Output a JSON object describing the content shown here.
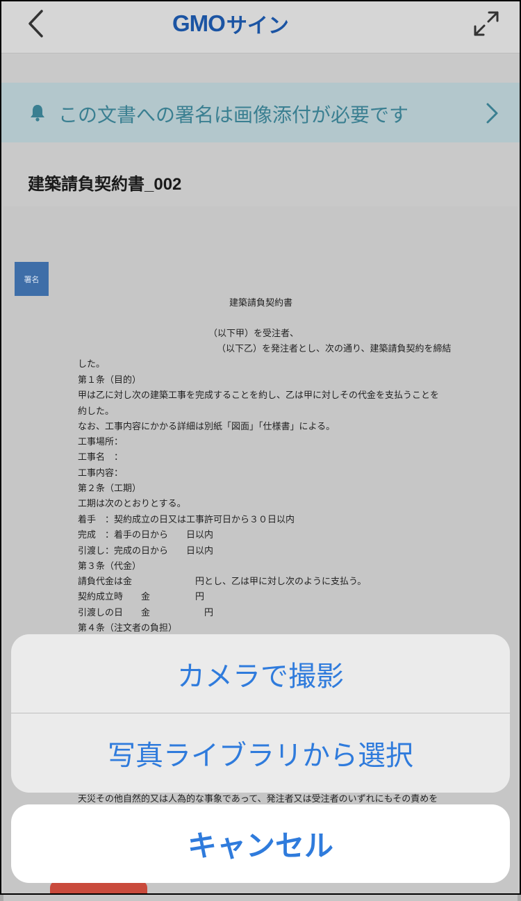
{
  "header": {
    "logo_gmo": "GMO",
    "logo_sign": "サイン"
  },
  "notice": {
    "text": "この文書への署名は画像添付が必要です"
  },
  "document": {
    "title": "建築請負契約書_002",
    "signature_label": "署名",
    "lines": [
      "建築請負契約書",
      "（以下甲）を受注者、",
      "（以下乙）を発注者とし、次の通り、建築請負契約を締結",
      "した。",
      "第１条（目的）",
      "甲は乙に対し次の建築工事を完成することを約し、乙は甲に対しその代金を支払うことを",
      "約した。",
      "なお、工事内容にかかる詳細は別紙「図面」「仕様書」による。",
      "工事場所：",
      "工事名　：",
      "工事内容：",
      "第２条（工期）",
      "工期は次のとおりとする。",
      "着手　：契約成立の日又は工事許可日から３０日以内",
      "完成　：着手の日から　　日以内",
      "引渡し：完成の日から　　日以内",
      "第３条（代金）",
      "請負代金は金　　　　　　　円とし、乙は甲に対し次のように支払う。",
      "契約成立時　　金　　　　　円",
      "引渡しの日　　金　　　　　　円",
      "第４条（注文者の負担）",
      "天災その他自然的又は人為的な事象であって、発注者又は受注者のいずれにもその責めを"
    ]
  },
  "action_sheet": {
    "camera_label": "カメラで撮影",
    "library_label": "写真ライブラリから選択",
    "cancel_label": "キャンセル"
  },
  "colors": {
    "brand": "#1b54a3",
    "notice_text": "#3a7f91",
    "action_blue": "#2f7bdc",
    "signature_box": "#3e6ea8"
  },
  "icons": [
    "back-chevron-icon",
    "expand-icon",
    "bell-icon",
    "chevron-right-icon"
  ]
}
